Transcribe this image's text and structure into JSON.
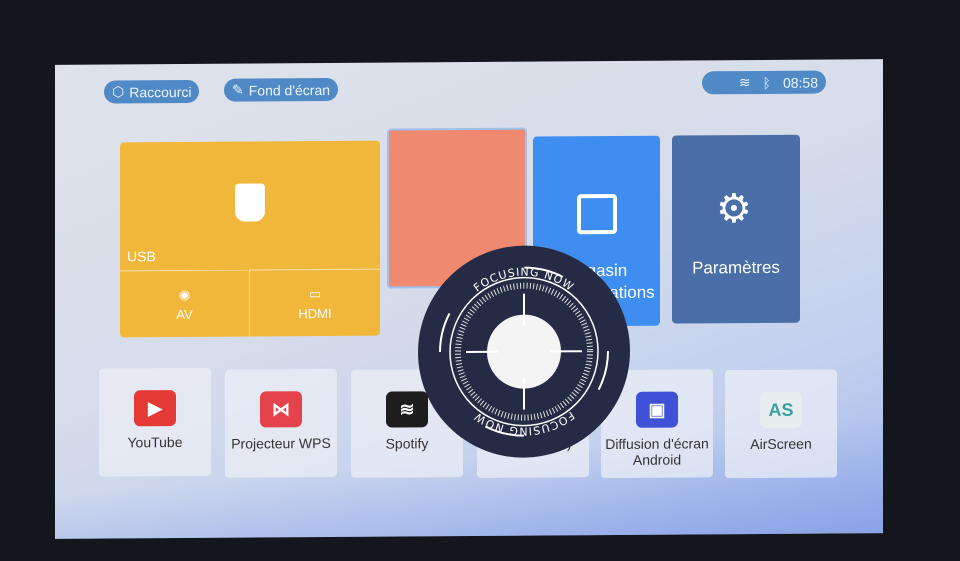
{
  "top_bar": {
    "shortcut_label": "Raccourci",
    "wallpaper_label": "Fond d'écran",
    "time": "08:58",
    "wifi_icon": "wifi-icon",
    "bluetooth_icon": "bluetooth-icon"
  },
  "tiles": {
    "usb": "USB",
    "av": "AV",
    "hdmi": "HDMI",
    "store_line1": "Magasin",
    "store_line2": "Applications",
    "settings": "Paramètres"
  },
  "apps": [
    {
      "label": "YouTube",
      "color": "#e53935"
    },
    {
      "label": "Projecteur WPS",
      "color": "#e4434b"
    },
    {
      "label": "Spotify",
      "color": "#1d1d1d"
    },
    {
      "label": "AirPin(PRO)",
      "color": "#8cc152"
    },
    {
      "label": "Diffusion d'écran Android",
      "color": "#3f51d6"
    },
    {
      "label": "AirScreen",
      "color": "#e8eef0"
    }
  ],
  "overlay": {
    "text": "FOCUSING NOW"
  },
  "colors": {
    "usb": "#f1b73a",
    "orange": "#ef8a70",
    "store": "#3d8ef0",
    "settings": "#4a6ea8",
    "pill": "#4f8ac6"
  }
}
